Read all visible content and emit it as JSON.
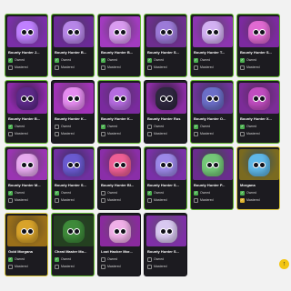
{
  "labels": {
    "owned": "Owned",
    "mastered": "Mastered"
  },
  "colors": {
    "owned_check": "#4caf50",
    "gold_check": "#e0b52f",
    "card_bg": "#1c1b20"
  },
  "scroll_top": {
    "icon": "arrow-up-icon",
    "glyph": "↑"
  },
  "cards": [
    {
      "name": "Bounty Hunter J...",
      "owned": true,
      "mastered": false,
      "bg": "#7a2fa8",
      "body": "#c080ff",
      "border": "green"
    },
    {
      "name": "Bounty Hunter B...",
      "owned": true,
      "mastered": false,
      "bg": "#6a2a96",
      "body": "#b786e8",
      "border": "green"
    },
    {
      "name": "Bounty Hunter B...",
      "owned": true,
      "mastered": false,
      "bg": "#a23bbf",
      "body": "#d99bf0",
      "border": "green"
    },
    {
      "name": "Bounty Hunter S...",
      "owned": true,
      "mastered": false,
      "bg": "#6e2e8f",
      "body": "#9c7ad8",
      "border": "green"
    },
    {
      "name": "Bounty Hunter T...",
      "owned": true,
      "mastered": false,
      "bg": "#8c35b0",
      "body": "#d3b1f2",
      "border": "green"
    },
    {
      "name": "Bounty Hunter S...",
      "owned": true,
      "mastered": false,
      "bg": "#7c2aa0",
      "body": "#e06ad2",
      "border": "green"
    },
    {
      "name": "Bounty Hunter B...",
      "owned": true,
      "mastered": false,
      "bg": "#8c2aa8",
      "body": "#5e2a8a",
      "border": "green"
    },
    {
      "name": "Bounty Hunter K...",
      "owned": false,
      "mastered": false,
      "bg": "#a232b8",
      "body": "#e58cf0",
      "border": "none"
    },
    {
      "name": "Bounty Hunter K...",
      "owned": true,
      "mastered": false,
      "bg": "#7a2a9e",
      "body": "#b56be0",
      "border": "green"
    },
    {
      "name": "Bounty Hunter Rus",
      "owned": false,
      "mastered": false,
      "bg": "#8b2ca4",
      "body": "#2f2840",
      "border": "none"
    },
    {
      "name": "Bounty Hunter O...",
      "owned": true,
      "mastered": false,
      "bg": "#6e3498",
      "body": "#6b6ec8",
      "border": "green"
    },
    {
      "name": "Bounty Hunter X...",
      "owned": true,
      "mastered": false,
      "bg": "#7c2c98",
      "body": "#c04cc0",
      "border": "green"
    },
    {
      "name": "Bounty Hunter M...",
      "owned": true,
      "mastered": false,
      "bg": "#9a34b2",
      "body": "#e7a9ef",
      "border": "green"
    },
    {
      "name": "Bounty Hunter S...",
      "owned": true,
      "mastered": false,
      "bg": "#7030a0",
      "body": "#6a5ad0",
      "border": "green"
    },
    {
      "name": "Bounty Hunter Bl...",
      "owned": false,
      "mastered": false,
      "bg": "#8a2ea8",
      "body": "#ee5f95",
      "border": "none"
    },
    {
      "name": "Bounty Hunter S...",
      "owned": true,
      "mastered": false,
      "bg": "#7a30a8",
      "body": "#9c88e8",
      "border": "green"
    },
    {
      "name": "Bounty Hunter P...",
      "owned": true,
      "mastered": false,
      "bg": "#6a2c8e",
      "body": "#74c878",
      "border": "green"
    },
    {
      "name": "Morgana",
      "owned": true,
      "mastered": true,
      "bg": "#7a6a20",
      "body": "#5fb8e8",
      "border": "gold"
    },
    {
      "name": "Gold Morgana",
      "owned": true,
      "mastered": false,
      "bg": "#9a6f1a",
      "body": "#d8a32a",
      "border": "gold"
    },
    {
      "name": "Cheat Master Mo...",
      "owned": true,
      "mastered": false,
      "bg": "#244020",
      "body": "#3e8a3a",
      "border": "green"
    },
    {
      "name": "Loot Hacker Mor...",
      "owned": false,
      "mastered": false,
      "bg": "#8a2a9e",
      "body": "#f0b0e8",
      "border": "none"
    },
    {
      "name": "Bounty Hunter S...",
      "owned": false,
      "mastered": false,
      "bg": "#7e2fa6",
      "body": "#d8c8f0",
      "border": "none"
    }
  ]
}
